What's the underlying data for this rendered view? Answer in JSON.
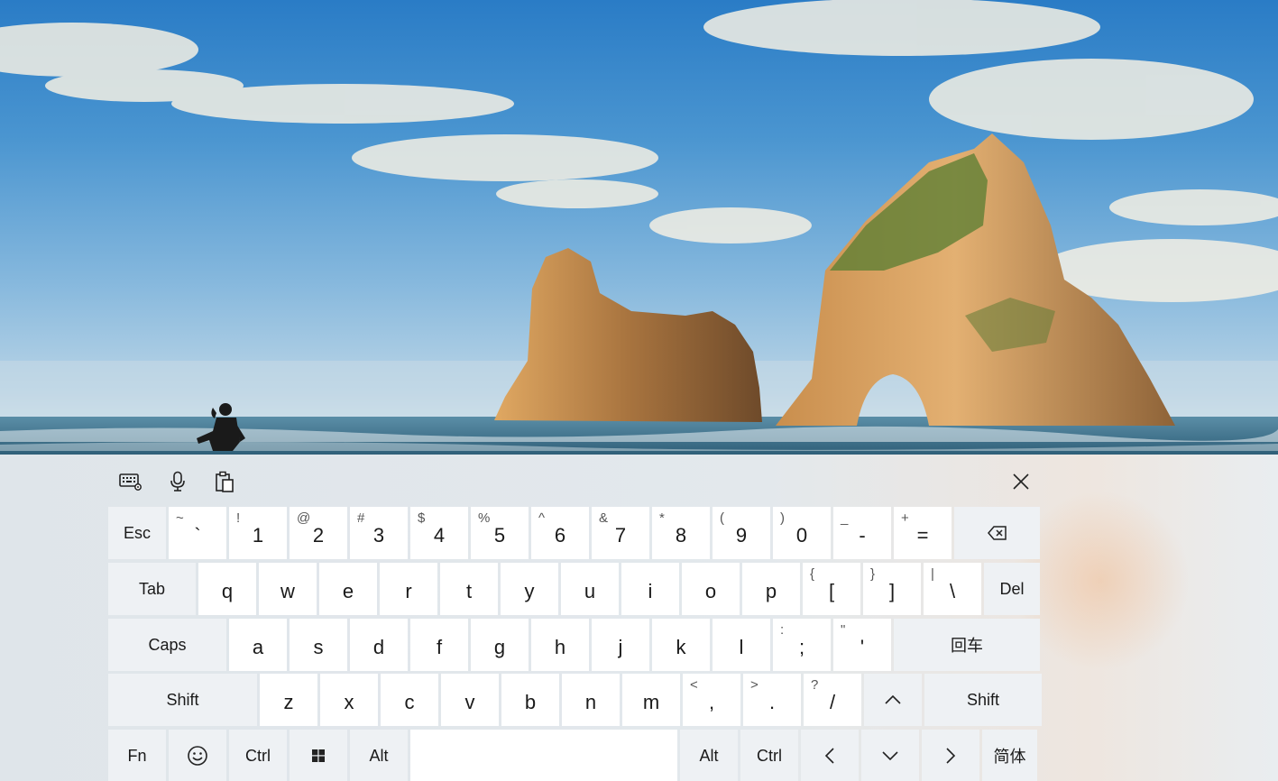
{
  "toolbar": {
    "settings_icon": "keyboard-settings-icon",
    "mic_icon": "microphone-icon",
    "clipboard_icon": "clipboard-icon",
    "close_icon": "close-icon"
  },
  "keyboard": {
    "row1": [
      {
        "id": "esc",
        "label": "Esc",
        "fn": true
      },
      {
        "id": "backtick",
        "label": "`",
        "shift": "~"
      },
      {
        "id": "1",
        "label": "1",
        "shift": "!"
      },
      {
        "id": "2",
        "label": "2",
        "shift": "@"
      },
      {
        "id": "3",
        "label": "3",
        "shift": "#"
      },
      {
        "id": "4",
        "label": "4",
        "shift": "$"
      },
      {
        "id": "5",
        "label": "5",
        "shift": "%"
      },
      {
        "id": "6",
        "label": "6",
        "shift": "^"
      },
      {
        "id": "7",
        "label": "7",
        "shift": "&"
      },
      {
        "id": "8",
        "label": "8",
        "shift": "*"
      },
      {
        "id": "9",
        "label": "9",
        "shift": "("
      },
      {
        "id": "0",
        "label": "0",
        "shift": ")"
      },
      {
        "id": "minus",
        "label": "-",
        "shift": "_"
      },
      {
        "id": "equals",
        "label": "=",
        "shift": "+"
      },
      {
        "id": "backspace",
        "label": "",
        "fn": true,
        "icon": "backspace-icon"
      }
    ],
    "row2": [
      {
        "id": "tab",
        "label": "Tab",
        "fn": true
      },
      {
        "id": "q",
        "label": "q"
      },
      {
        "id": "w",
        "label": "w"
      },
      {
        "id": "e",
        "label": "e"
      },
      {
        "id": "r",
        "label": "r"
      },
      {
        "id": "t",
        "label": "t"
      },
      {
        "id": "y",
        "label": "y"
      },
      {
        "id": "u",
        "label": "u"
      },
      {
        "id": "i",
        "label": "i"
      },
      {
        "id": "o",
        "label": "o"
      },
      {
        "id": "p",
        "label": "p"
      },
      {
        "id": "lbracket",
        "label": "[",
        "shift": "{"
      },
      {
        "id": "rbracket",
        "label": "]",
        "shift": "}"
      },
      {
        "id": "backslash",
        "label": "\\",
        "shift": "|"
      },
      {
        "id": "del",
        "label": "Del",
        "fn": true
      }
    ],
    "row3": [
      {
        "id": "caps",
        "label": "Caps",
        "fn": true
      },
      {
        "id": "a",
        "label": "a"
      },
      {
        "id": "s",
        "label": "s"
      },
      {
        "id": "d",
        "label": "d"
      },
      {
        "id": "f",
        "label": "f"
      },
      {
        "id": "g",
        "label": "g"
      },
      {
        "id": "h",
        "label": "h"
      },
      {
        "id": "j",
        "label": "j"
      },
      {
        "id": "k",
        "label": "k"
      },
      {
        "id": "l",
        "label": "l"
      },
      {
        "id": "semicolon",
        "label": ";",
        "shift": ":"
      },
      {
        "id": "quote",
        "label": "'",
        "shift": "\""
      },
      {
        "id": "enter",
        "label": "回车",
        "fn": true
      }
    ],
    "row4": [
      {
        "id": "lshift",
        "label": "Shift",
        "fn": true
      },
      {
        "id": "z",
        "label": "z"
      },
      {
        "id": "x",
        "label": "x"
      },
      {
        "id": "c",
        "label": "c"
      },
      {
        "id": "v",
        "label": "v"
      },
      {
        "id": "b",
        "label": "b"
      },
      {
        "id": "n",
        "label": "n"
      },
      {
        "id": "m",
        "label": "m"
      },
      {
        "id": "comma",
        "label": ",",
        "shift": "<"
      },
      {
        "id": "period",
        "label": ".",
        "shift": ">"
      },
      {
        "id": "slash",
        "label": "/",
        "shift": "?"
      },
      {
        "id": "up",
        "label": "",
        "fn": true,
        "icon": "chevron-up-icon"
      },
      {
        "id": "rshift",
        "label": "Shift",
        "fn": true
      }
    ],
    "row5": [
      {
        "id": "fn",
        "label": "Fn",
        "fn": true
      },
      {
        "id": "emoji",
        "label": "",
        "fn": true,
        "icon": "emoji-icon"
      },
      {
        "id": "lctrl",
        "label": "Ctrl",
        "fn": true
      },
      {
        "id": "win",
        "label": "",
        "fn": true,
        "icon": "windows-logo-icon"
      },
      {
        "id": "lalt",
        "label": "Alt",
        "fn": true
      },
      {
        "id": "space",
        "label": ""
      },
      {
        "id": "ralt",
        "label": "Alt",
        "fn": true
      },
      {
        "id": "rctrl",
        "label": "Ctrl",
        "fn": true
      },
      {
        "id": "left",
        "label": "",
        "fn": true,
        "icon": "chevron-left-icon"
      },
      {
        "id": "down",
        "label": "",
        "fn": true,
        "icon": "chevron-down-icon"
      },
      {
        "id": "right",
        "label": "",
        "fn": true,
        "icon": "chevron-right-icon"
      },
      {
        "id": "lang",
        "label": "简体",
        "fn": true
      }
    ]
  }
}
